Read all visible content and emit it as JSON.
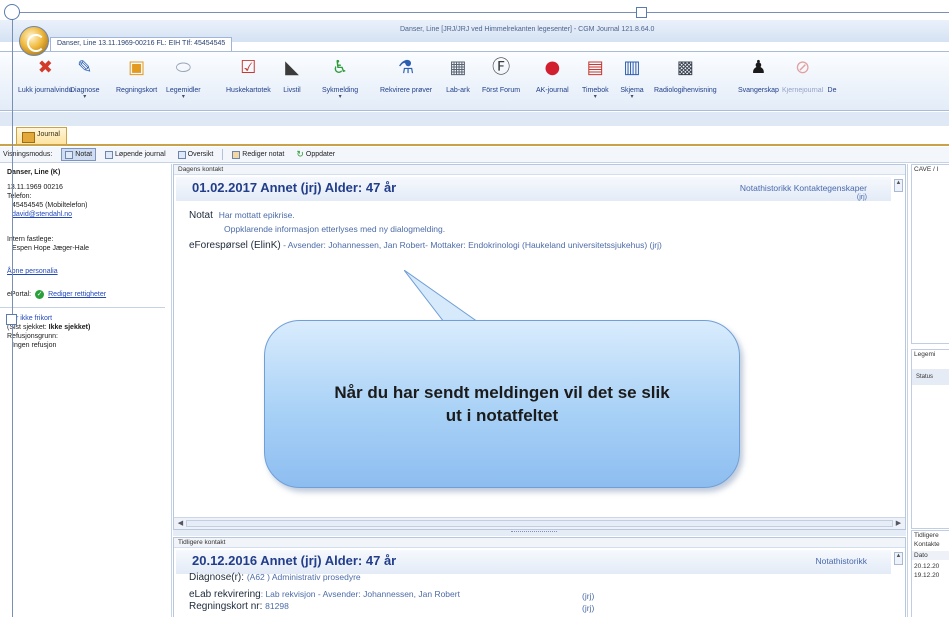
{
  "window": {
    "title": "Danser, Line [JRJ/JRJ ved Himmelrekanten legesenter] - CGM Journal 121.8.64.0",
    "doc_tab": "Danser, Line 13.11.1969-00216 FL: EIH TIf: 45454545"
  },
  "ribbon": [
    {
      "label": "Lukk journalvindu",
      "icon": "close-x-icon",
      "glyph": "✖",
      "color": "#d23a2a",
      "dropdown": false,
      "disabled": false
    },
    {
      "label": "Diagnose",
      "icon": "pen-icon",
      "glyph": "✎",
      "color": "#2d5fb0",
      "dropdown": true,
      "disabled": false
    },
    {
      "label": "Regningskort",
      "icon": "card-icon",
      "glyph": "▣",
      "color": "#e39a1e",
      "dropdown": false,
      "disabled": false
    },
    {
      "label": "Legemidler",
      "icon": "pill-icon",
      "glyph": "⬭",
      "color": "#9aa7b6",
      "dropdown": true,
      "disabled": false
    },
    {
      "label": "Huskekartotek",
      "icon": "checklist-icon",
      "glyph": "☑",
      "color": "#c9382f",
      "dropdown": false,
      "disabled": false
    },
    {
      "label": "Livstil",
      "icon": "shoe-icon",
      "glyph": "◣",
      "color": "#3b3b3b",
      "dropdown": false,
      "disabled": false
    },
    {
      "label": "Sykmelding",
      "icon": "wheelchair-icon",
      "glyph": "♿",
      "color": "#2e9c3a",
      "dropdown": true,
      "disabled": false
    },
    {
      "label": "Rekvirere prøver",
      "icon": "test-tube-icon",
      "glyph": "⚗",
      "color": "#2d5fb0",
      "dropdown": false,
      "disabled": false
    },
    {
      "label": "Lab-ark",
      "icon": "lab-sheet-icon",
      "glyph": "▦",
      "color": "#5a6472",
      "dropdown": false,
      "disabled": false
    },
    {
      "label": "Först Forum",
      "icon": "forum-icon",
      "glyph": "Ⓕ",
      "color": "#3b3b3b",
      "dropdown": false,
      "disabled": false
    },
    {
      "label": "AK-journal",
      "icon": "blood-drop-icon",
      "glyph": "●",
      "color": "#d21f2f",
      "dropdown": false,
      "disabled": false
    },
    {
      "label": "Timebok",
      "icon": "calendar-icon",
      "glyph": "▤",
      "color": "#c9382f",
      "dropdown": true,
      "disabled": false
    },
    {
      "label": "Skjema",
      "icon": "form-icon",
      "glyph": "▥",
      "color": "#2d5fb0",
      "dropdown": true,
      "disabled": false
    },
    {
      "label": "Radiologihenvisning",
      "icon": "xray-icon",
      "glyph": "▩",
      "color": "#3b4350",
      "dropdown": false,
      "disabled": false
    },
    {
      "label": "Svangerskap",
      "icon": "pregnancy-icon",
      "glyph": "♟",
      "color": "#1b1b1b",
      "dropdown": false,
      "disabled": false
    },
    {
      "label": "Kjernejournal",
      "icon": "core-journal-icon",
      "glyph": "⊘",
      "color": "#c9382f",
      "dropdown": false,
      "disabled": true
    },
    {
      "label": "De",
      "icon": "more-icon",
      "glyph": "",
      "color": "#2d5fb0",
      "dropdown": false,
      "disabled": false
    }
  ],
  "journal_tab": "Journal",
  "view_bar": {
    "label": "Visningsmodus:",
    "notat": "Notat",
    "lopende": "Løpende journal",
    "oversikt": "Oversikt",
    "rediger": "Rediger notat",
    "oppdater": "Oppdater"
  },
  "patient": {
    "name": "Danser, Line (K)",
    "dob": "13.11.1969 00216",
    "phone_label": "Telefon:",
    "phone": "45454545 (Mobiltelefon)",
    "email": "david@stendahl.no",
    "gp_label": "Intern fastlege:",
    "gp": "Espen Hope Jæger-Hale",
    "open_personalia": "Åpne personalia",
    "eportal_label": "ePortal:",
    "edit_rights": "Rediger rettigheter",
    "frikort": "Har ikke frikort",
    "checked_label": "(Sist sjekket:",
    "checked_value": "Ikke sjekket)",
    "refund_label": "Refusjonsgrunn:",
    "refund_value": "Ingen refusjon"
  },
  "current": {
    "section_label": "Dagens kontakt",
    "header": "01.02.2017 Annet (jrj) Alder: 47 år",
    "links": "Notathistorikk  Kontaktegenskaper",
    "initials": "(jrj)",
    "notat_label": "Notat",
    "notat_line1": "Har mottatt epikrise.",
    "notat_line2": "Oppklarende informasjon etterlyses med ny dialogmelding.",
    "eforesporsel_label": "eForespørsel (ElinK)",
    "eforesporsel_text": " - Avsender: Johannessen, Jan Robert- Mottaker: Endokrinologi (Haukeland universitetssjukehus)  (jrj)"
  },
  "callout": {
    "text": "Når du har sendt meldingen vil det se slik ut i notatfeltet"
  },
  "previous": {
    "section_label": "Tidligere kontakt",
    "header": "20.12.2016 Annet (jrj) Alder: 47 år",
    "link": "Notathistorikk",
    "diag_label": "Diagnose(r):",
    "diag_value": "(A62 ) Administrativ prosedyre",
    "lab_label": "eLab rekvirering",
    "lab_value": ": Lab rekvisjon - Avsender: Johannessen, Jan Robert",
    "lab_init": "(jrj)",
    "regn_label": "Regningskort nr:",
    "regn_value": "81298",
    "regn_init": "(jrj)"
  },
  "right_panel": {
    "cave": "CAVE / I",
    "legemidler": "Legemi",
    "status": "Status",
    "tidligere": "Tidligere",
    "kontakt": "Kontakte",
    "dato": "Dato",
    "date1": "20.12.20",
    "date2": "19.12.20"
  }
}
